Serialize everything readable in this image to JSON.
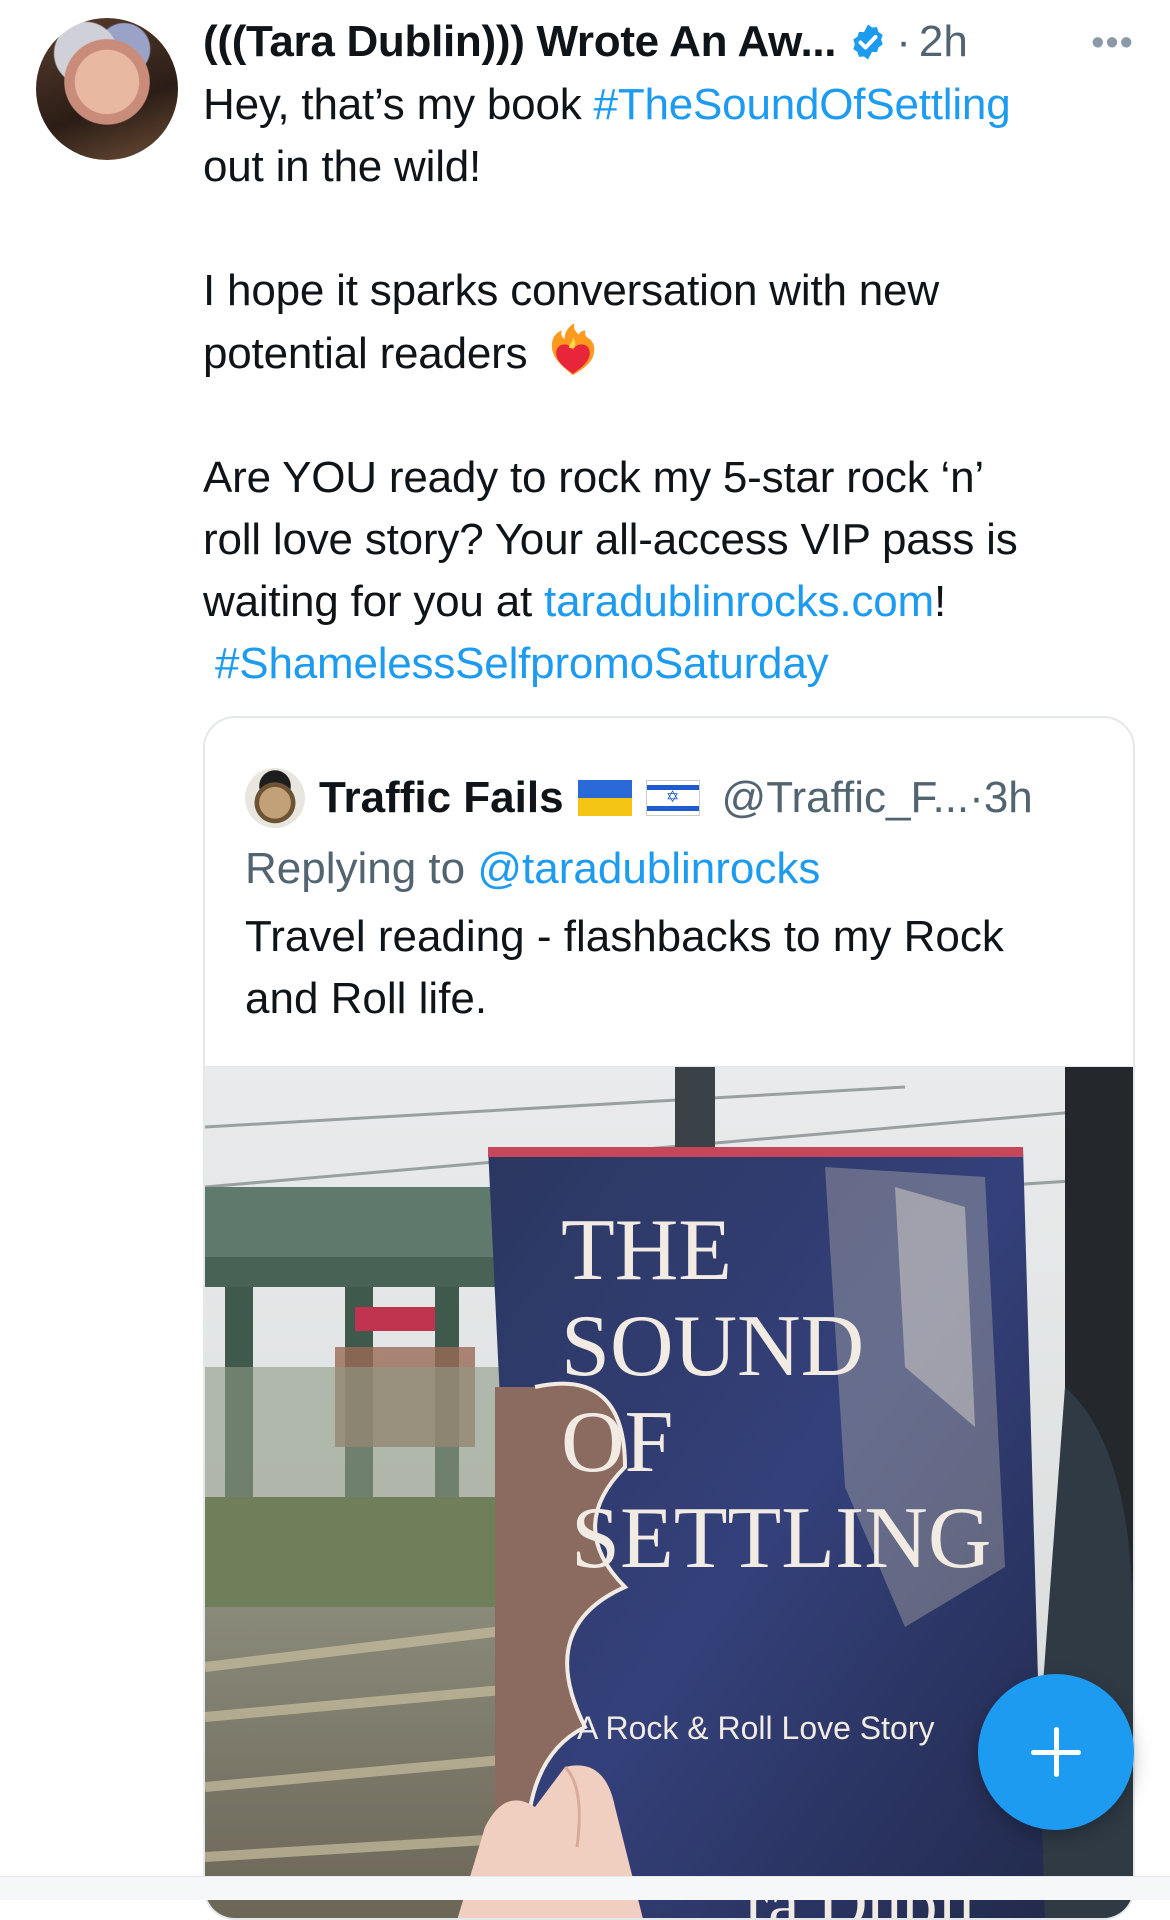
{
  "tweet": {
    "author_name": "(((Tara Dublin))) Wrote An Aw...",
    "separator": "·",
    "time": "2h",
    "more_label": "•••",
    "text_p1_before": "Hey, that’s my book ",
    "hashtag_1": "#TheSoundOfSettling",
    "text_p1_after": "\nout in the wild!\n\nI hope it sparks conversation with new\npotential readers ",
    "text_p2_before": "\n\nAre YOU ready to rock my 5-star rock ‘n’\nroll love story? Your all-access VIP pass is\nwaiting for you at ",
    "link_url": "taradublinrocks.com",
    "text_p2_after": "!\n ",
    "hashtag_2": "#ShamelessSelfpromoSaturday"
  },
  "quoted_tweet": {
    "author_name": "Traffic Fails",
    "handle": "@Traffic_F...",
    "separator": "·",
    "time": "3h",
    "replying_prefix": "Replying to ",
    "replying_handle": "@taradublinrocks",
    "text": "Travel reading - flashbacks to my Rock\nand Roll life.",
    "image": {
      "book_title_line1": "THE",
      "book_title_line2": "SOUND",
      "book_title_line3": "OF",
      "book_title_line4": "SETTLING",
      "book_subtitle": "A Rock & Roll Love Story",
      "book_author_partial": "ra Dubli"
    }
  },
  "icons": {
    "verified": "verified-badge-icon",
    "fire_heart": "heart-on-fire-emoji",
    "compose": "plus-icon"
  },
  "colors": {
    "link": "#1d9bf0",
    "secondary_text": "#536471",
    "fab": "#1d9bf0"
  }
}
